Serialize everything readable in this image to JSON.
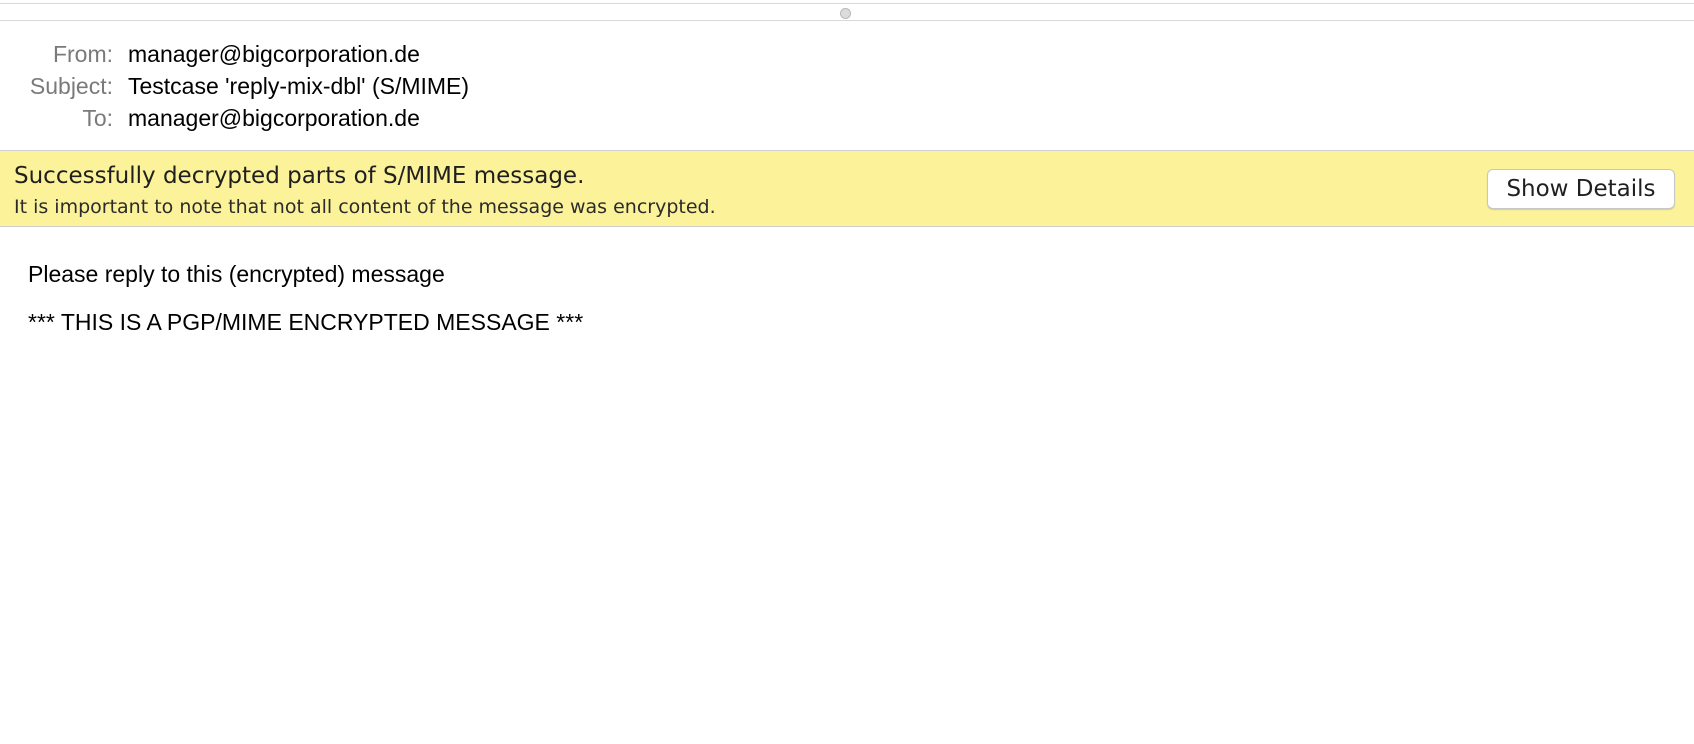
{
  "headers": {
    "from": {
      "label": "From:",
      "value": "manager@bigcorporation.de"
    },
    "subject": {
      "label": "Subject:",
      "value": "Testcase 'reply-mix-dbl' (S/MIME)"
    },
    "to": {
      "label": "To:",
      "value": "manager@bigcorporation.de"
    }
  },
  "banner": {
    "title": "Successfully decrypted parts of S/MIME message.",
    "subtitle": "It is important to note that not all content of the message was encrypted.",
    "button_label": "Show Details",
    "background_color": "#fbf29a"
  },
  "message_body": {
    "lines": [
      "Please reply to this (encrypted) message",
      "*** THIS IS A PGP/MIME ENCRYPTED MESSAGE ***"
    ]
  }
}
